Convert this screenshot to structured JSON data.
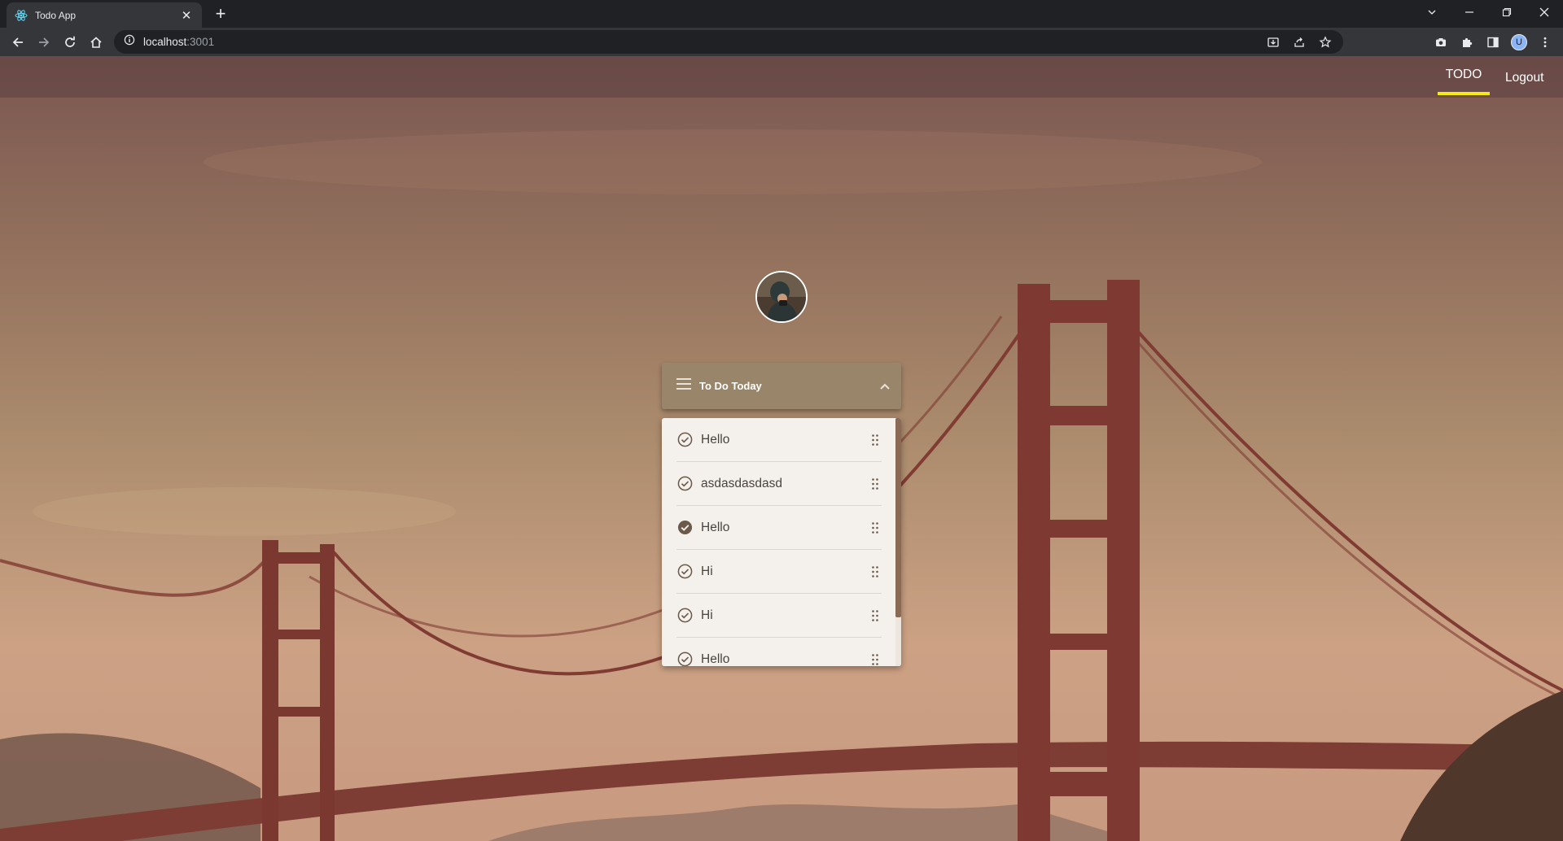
{
  "browser": {
    "tab_title": "Todo App",
    "tab_close": "✕",
    "new_tab": "+",
    "url_host": "localhost",
    "url_port": ":3001",
    "profile_initial": "U"
  },
  "header": {
    "nav_todo": "TODO",
    "nav_logout": "Logout",
    "active_underline_color": "#f5ea12"
  },
  "card": {
    "title": "To Do Today",
    "header_color": "#998569"
  },
  "todos": [
    {
      "text": "Hello",
      "completed": false
    },
    {
      "text": "asdasdasdasd",
      "completed": false
    },
    {
      "text": "Hello",
      "completed": true
    },
    {
      "text": "Hi",
      "completed": false
    },
    {
      "text": "Hi",
      "completed": false
    },
    {
      "text": "Hello",
      "completed": false
    }
  ]
}
